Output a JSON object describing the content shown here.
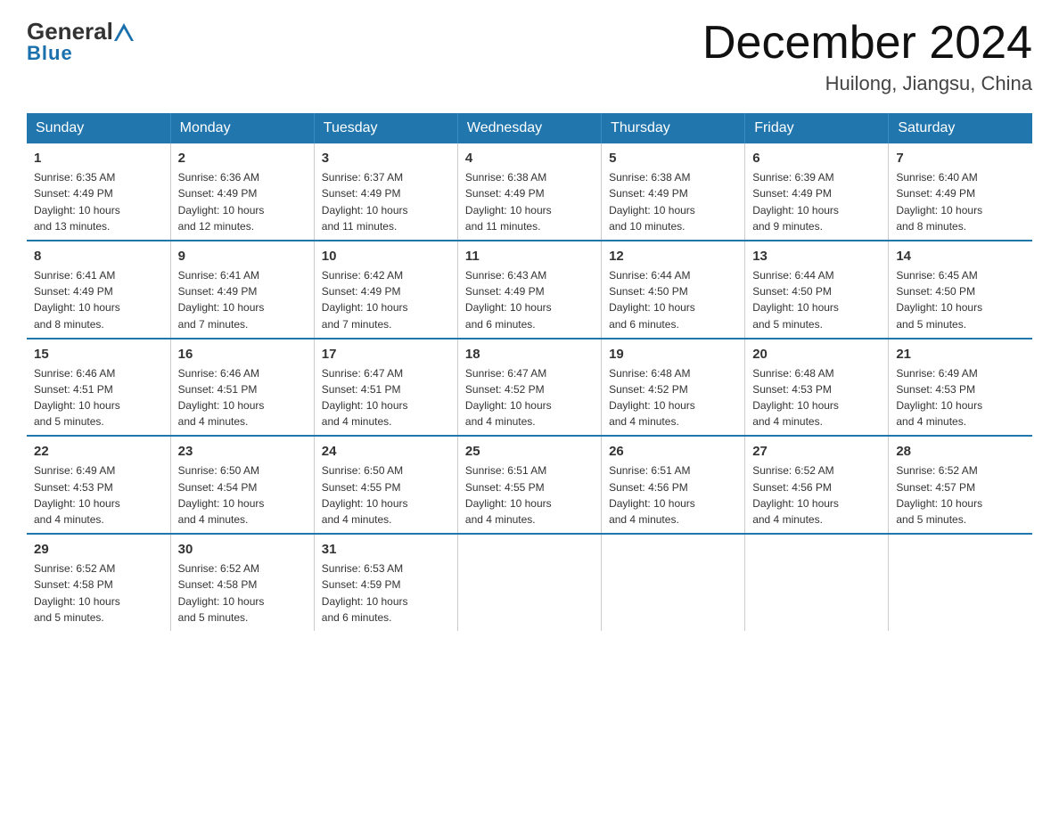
{
  "header": {
    "logo": {
      "text_general": "General",
      "text_blue": "Blue"
    },
    "title": "December 2024",
    "subtitle": "Huilong, Jiangsu, China"
  },
  "calendar": {
    "days_of_week": [
      "Sunday",
      "Monday",
      "Tuesday",
      "Wednesday",
      "Thursday",
      "Friday",
      "Saturday"
    ],
    "weeks": [
      [
        {
          "day": "1",
          "sunrise": "6:35 AM",
          "sunset": "4:49 PM",
          "daylight": "10 hours and 13 minutes."
        },
        {
          "day": "2",
          "sunrise": "6:36 AM",
          "sunset": "4:49 PM",
          "daylight": "10 hours and 12 minutes."
        },
        {
          "day": "3",
          "sunrise": "6:37 AM",
          "sunset": "4:49 PM",
          "daylight": "10 hours and 11 minutes."
        },
        {
          "day": "4",
          "sunrise": "6:38 AM",
          "sunset": "4:49 PM",
          "daylight": "10 hours and 11 minutes."
        },
        {
          "day": "5",
          "sunrise": "6:38 AM",
          "sunset": "4:49 PM",
          "daylight": "10 hours and 10 minutes."
        },
        {
          "day": "6",
          "sunrise": "6:39 AM",
          "sunset": "4:49 PM",
          "daylight": "10 hours and 9 minutes."
        },
        {
          "day": "7",
          "sunrise": "6:40 AM",
          "sunset": "4:49 PM",
          "daylight": "10 hours and 8 minutes."
        }
      ],
      [
        {
          "day": "8",
          "sunrise": "6:41 AM",
          "sunset": "4:49 PM",
          "daylight": "10 hours and 8 minutes."
        },
        {
          "day": "9",
          "sunrise": "6:41 AM",
          "sunset": "4:49 PM",
          "daylight": "10 hours and 7 minutes."
        },
        {
          "day": "10",
          "sunrise": "6:42 AM",
          "sunset": "4:49 PM",
          "daylight": "10 hours and 7 minutes."
        },
        {
          "day": "11",
          "sunrise": "6:43 AM",
          "sunset": "4:49 PM",
          "daylight": "10 hours and 6 minutes."
        },
        {
          "day": "12",
          "sunrise": "6:44 AM",
          "sunset": "4:50 PM",
          "daylight": "10 hours and 6 minutes."
        },
        {
          "day": "13",
          "sunrise": "6:44 AM",
          "sunset": "4:50 PM",
          "daylight": "10 hours and 5 minutes."
        },
        {
          "day": "14",
          "sunrise": "6:45 AM",
          "sunset": "4:50 PM",
          "daylight": "10 hours and 5 minutes."
        }
      ],
      [
        {
          "day": "15",
          "sunrise": "6:46 AM",
          "sunset": "4:51 PM",
          "daylight": "10 hours and 5 minutes."
        },
        {
          "day": "16",
          "sunrise": "6:46 AM",
          "sunset": "4:51 PM",
          "daylight": "10 hours and 4 minutes."
        },
        {
          "day": "17",
          "sunrise": "6:47 AM",
          "sunset": "4:51 PM",
          "daylight": "10 hours and 4 minutes."
        },
        {
          "day": "18",
          "sunrise": "6:47 AM",
          "sunset": "4:52 PM",
          "daylight": "10 hours and 4 minutes."
        },
        {
          "day": "19",
          "sunrise": "6:48 AM",
          "sunset": "4:52 PM",
          "daylight": "10 hours and 4 minutes."
        },
        {
          "day": "20",
          "sunrise": "6:48 AM",
          "sunset": "4:53 PM",
          "daylight": "10 hours and 4 minutes."
        },
        {
          "day": "21",
          "sunrise": "6:49 AM",
          "sunset": "4:53 PM",
          "daylight": "10 hours and 4 minutes."
        }
      ],
      [
        {
          "day": "22",
          "sunrise": "6:49 AM",
          "sunset": "4:53 PM",
          "daylight": "10 hours and 4 minutes."
        },
        {
          "day": "23",
          "sunrise": "6:50 AM",
          "sunset": "4:54 PM",
          "daylight": "10 hours and 4 minutes."
        },
        {
          "day": "24",
          "sunrise": "6:50 AM",
          "sunset": "4:55 PM",
          "daylight": "10 hours and 4 minutes."
        },
        {
          "day": "25",
          "sunrise": "6:51 AM",
          "sunset": "4:55 PM",
          "daylight": "10 hours and 4 minutes."
        },
        {
          "day": "26",
          "sunrise": "6:51 AM",
          "sunset": "4:56 PM",
          "daylight": "10 hours and 4 minutes."
        },
        {
          "day": "27",
          "sunrise": "6:52 AM",
          "sunset": "4:56 PM",
          "daylight": "10 hours and 4 minutes."
        },
        {
          "day": "28",
          "sunrise": "6:52 AM",
          "sunset": "4:57 PM",
          "daylight": "10 hours and 5 minutes."
        }
      ],
      [
        {
          "day": "29",
          "sunrise": "6:52 AM",
          "sunset": "4:58 PM",
          "daylight": "10 hours and 5 minutes."
        },
        {
          "day": "30",
          "sunrise": "6:52 AM",
          "sunset": "4:58 PM",
          "daylight": "10 hours and 5 minutes."
        },
        {
          "day": "31",
          "sunrise": "6:53 AM",
          "sunset": "4:59 PM",
          "daylight": "10 hours and 6 minutes."
        },
        {
          "day": "",
          "sunrise": "",
          "sunset": "",
          "daylight": ""
        },
        {
          "day": "",
          "sunrise": "",
          "sunset": "",
          "daylight": ""
        },
        {
          "day": "",
          "sunrise": "",
          "sunset": "",
          "daylight": ""
        },
        {
          "day": "",
          "sunrise": "",
          "sunset": "",
          "daylight": ""
        }
      ]
    ],
    "labels": {
      "sunrise": "Sunrise:",
      "sunset": "Sunset:",
      "daylight": "Daylight:"
    }
  }
}
